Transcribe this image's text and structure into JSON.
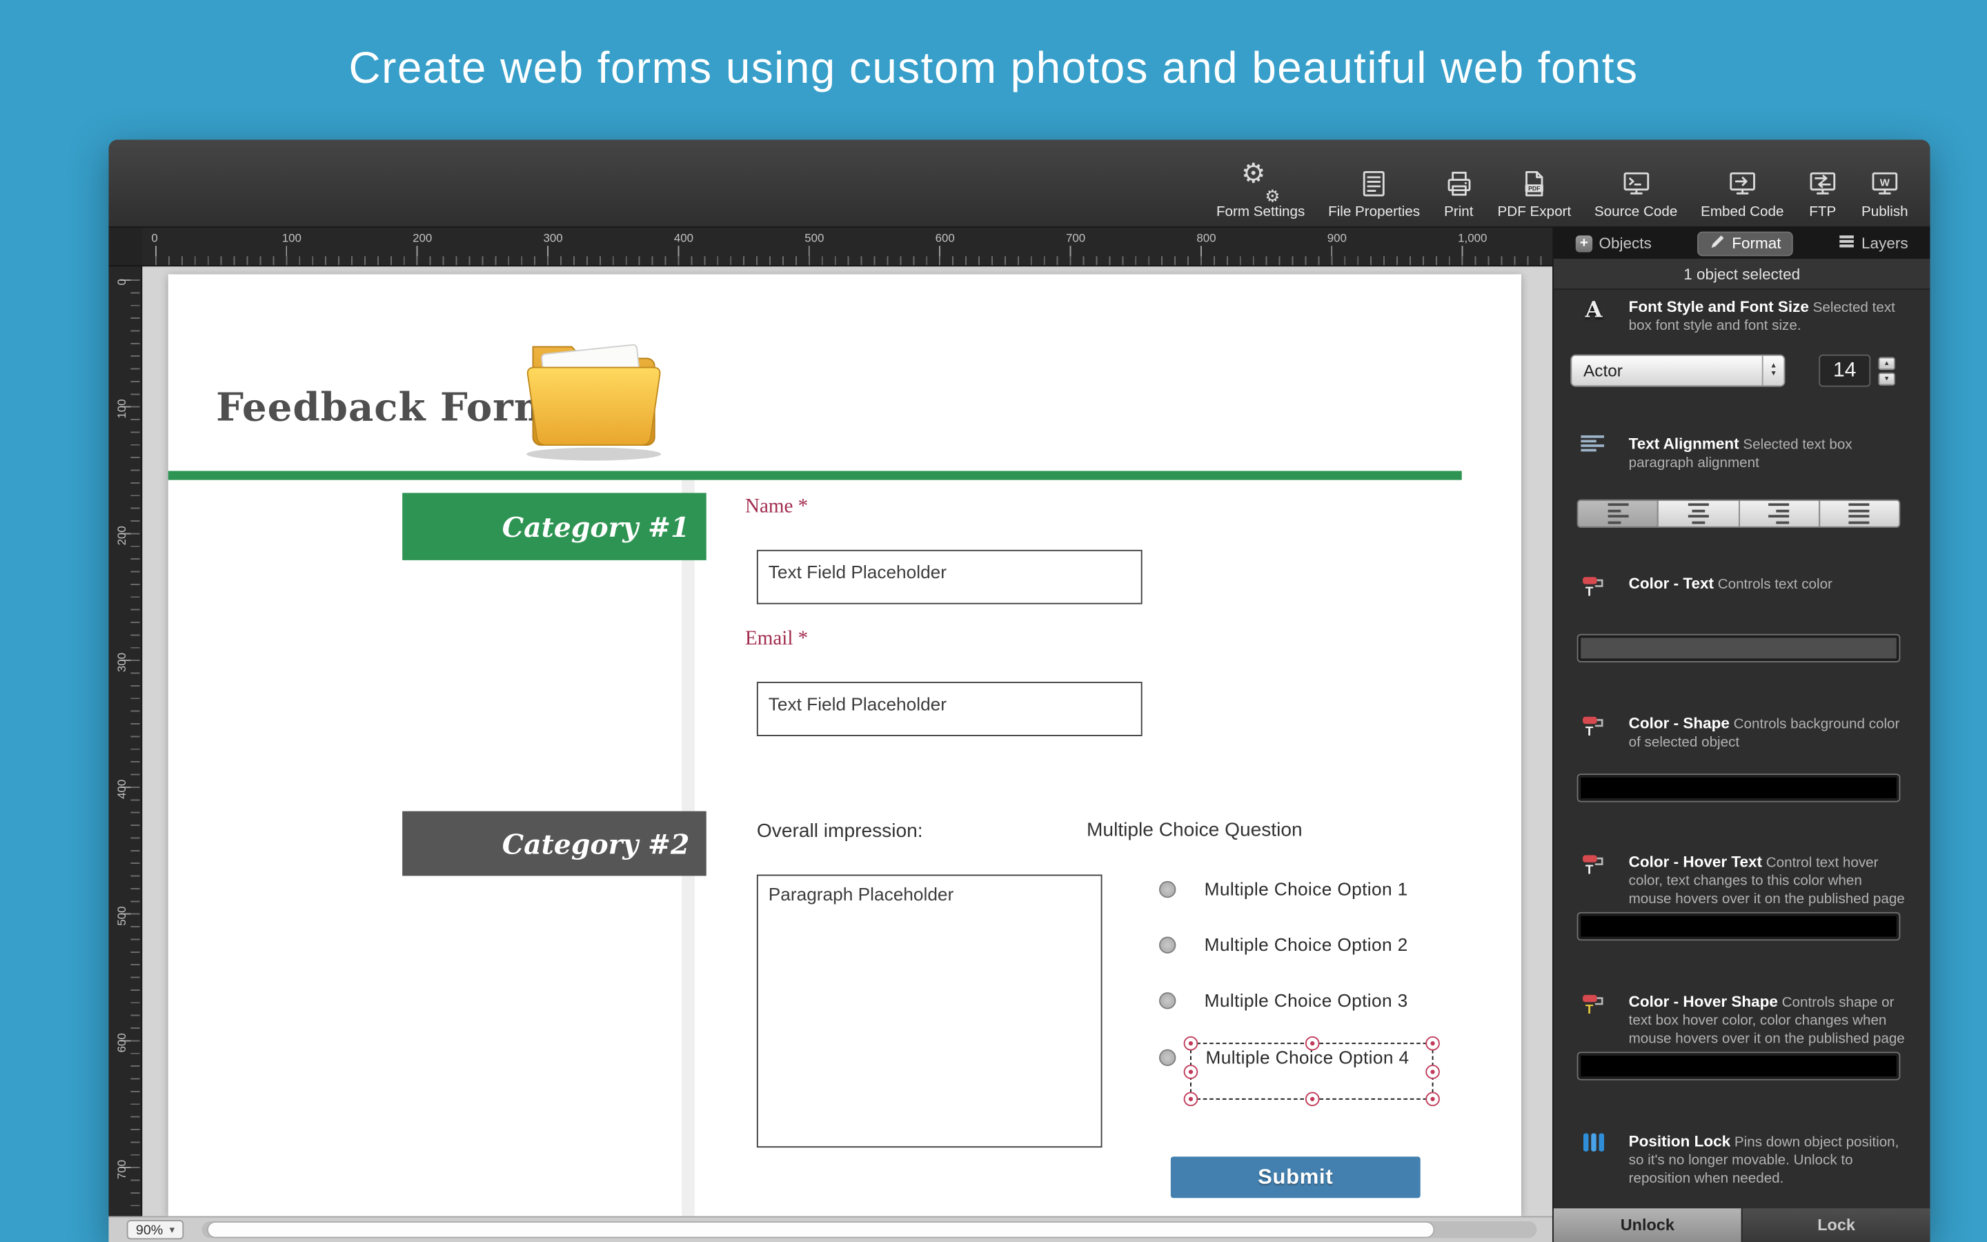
{
  "banner": {
    "title": "Create web forms using custom photos and beautiful web fonts"
  },
  "toolbar": {
    "items": [
      {
        "label": "Form Settings",
        "icon": "gears-icon"
      },
      {
        "label": "File Properties",
        "icon": "file-properties-icon"
      },
      {
        "label": "Print",
        "icon": "printer-icon"
      },
      {
        "label": "PDF Export",
        "icon": "pdf-icon"
      },
      {
        "label": "Source Code",
        "icon": "source-code-icon"
      },
      {
        "label": "Embed Code",
        "icon": "embed-code-icon"
      },
      {
        "label": "FTP",
        "icon": "ftp-icon"
      },
      {
        "label": "Publish",
        "icon": "publish-icon"
      }
    ]
  },
  "panel": {
    "tabs": [
      {
        "label": "Objects",
        "icon": "plus-icon",
        "selected": false
      },
      {
        "label": "Format",
        "icon": "pencil-icon",
        "selected": true
      },
      {
        "label": "Layers",
        "icon": "layers-icon",
        "selected": false
      }
    ],
    "status": "1 object selected",
    "font_section": {
      "title": "Font Style and Font Size",
      "desc": "Selected text box font style and font size.",
      "font_name": "Actor",
      "font_size": "14"
    },
    "alignment_section": {
      "title": "Text Alignment",
      "desc": "Selected text box paragraph alignment"
    },
    "color_sections": [
      {
        "title": "Color - Text",
        "desc": "Controls text color",
        "swatch": "#4e4e4e"
      },
      {
        "title": "Color - Shape",
        "desc": "Controls background color of selected object",
        "swatch": "#000000"
      },
      {
        "title": "Color - Hover Text",
        "desc": "Control text hover color, text changes to this color when mouse hovers over it on the published page",
        "swatch": "#000000"
      },
      {
        "title": "Color - Hover Shape",
        "desc": "Controls shape or text box hover color, color changes when mouse hovers over it on the published page",
        "swatch": "#000000"
      }
    ],
    "position_lock": {
      "title": "Position Lock",
      "desc": "Pins down object position, so it's no longer movable.  Unlock to reposition when needed.",
      "unlock_label": "Unlock",
      "lock_label": "Lock"
    }
  },
  "ruler": {
    "horizontal": [
      "0",
      "100",
      "200",
      "300",
      "400",
      "500",
      "600",
      "700",
      "800",
      "900",
      "1,000"
    ],
    "vertical": [
      "0",
      "100",
      "200",
      "300",
      "400",
      "500",
      "600",
      "700"
    ]
  },
  "form": {
    "title": "Feedback Form",
    "category1": "Category #1",
    "category2": "Category #2",
    "name_label": "Name *",
    "email_label": "Email *",
    "text_field_placeholder": "Text Field Placeholder",
    "overall_label": "Overall impression:",
    "paragraph_placeholder": "Paragraph Placeholder",
    "mc_question": "Multiple Choice Question",
    "options": [
      "Multiple Choice Option 1",
      "Multiple Choice Option 2",
      "Multiple Choice Option 3",
      "Multiple Choice Option 4"
    ],
    "submit_label": "Submit"
  },
  "statusbar": {
    "zoom": "90%"
  },
  "colors": {
    "background": "#379fc9",
    "category1": "#2e9453",
    "divider_green": "#2e9453",
    "category2": "#565656",
    "label_maroon": "#a22c4e",
    "submit_bg": "#4380af",
    "selection_handle": "#c23b5a"
  }
}
